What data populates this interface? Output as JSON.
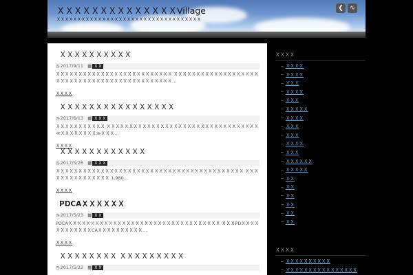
{
  "site": {
    "title": "ＸＸＸＸＸＸＸＸＸＸＸＸＸＸVillage",
    "tagline": "ＸＸＸＸＸＸＸＸＸＸＸＸＸＸＸＸＸＸＸＸＸＸＸＸＸＸＸＸＸＸＸＸＸＸＸ",
    "icons": [
      "feedly-icon",
      "rss-icon"
    ]
  },
  "posts": [
    {
      "title": "ＸＸＸＸＸＸＸＸＸＸ",
      "date": "2017/9/11",
      "category": "ＸＸ",
      "excerpt": "ＸＸＸＸＸＸＸＸＸＸＸＸＸＸＸＸＸＸＸＸＸＸＸＸＸＸ ＸＸＸＸＸＸＸＸＸＸＸＸＸＸＸＸＸＸＸＸＸＸＸＸＸＸＸＸＸＸＸＸＸＸＸＸＸＸＸＸＸＸＸＸＸ…",
      "more": "ＸＸＸＸ"
    },
    {
      "title": "ＸＸＸＸＸＸＸＸＸＸＸＸＸＸＸＸ",
      "date": "2017/6/13",
      "category": "ＸＸＸ",
      "excerpt": "ＸＸＸＸＸＸＸＸＸＸＸ ＸＸＸＸＸＸＸＸＸＸＸＸＸＸＸＸＸＸＸＸＸＸＸＸＸＸＸＸＸＸＸＸＸＸ ≪ＸＸＸＸＸＸＸＸ≫ＸＸＸ…",
      "more": "ＸＸＸＸ"
    },
    {
      "title": "ＸＸＸＸＸＸＸＸＸＸＸＸ",
      "date": "2017/5/26",
      "category": "ＸＸＸ",
      "excerpt": "ＸＸＸＸＸＸＸＸＸＸＸＸＸＸＸＸＸＸＸＸＸＸＸＸＸＸＸＸＸＸＸＸＸＸＸＸＸＸＸＸＸＸ ＸＸＸＸＸＸＸＸＸＸＸＸＸＸＸ 1,980…",
      "more": "ＸＸＸＸ"
    },
    {
      "title": "PDCAＸＸＸＸＸＸ",
      "date": "2017/5/23",
      "category": "ＸＸ",
      "excerpt": "PDCAＸＸＸＸＸＸＸＸＸＸＸＸＸＸＸＸＸＸＸＸＸＸＸＸＸＸＸＸＸＸＸＸＸＸ ＸＸＸPDＸＸＸＸＸＸＸＸＸＸＸＸCAＸＸＸＸＸＸＸＸＸＸ…",
      "more": "ＸＸＸＸ"
    },
    {
      "title": "ＸＸＸＸＸＸＸＸ ＸＸＸＸＸＸＸＸＸ",
      "date": "2017/5/22",
      "category": "ＸＸ",
      "excerpt": "",
      "more": ""
    }
  ],
  "sidebar": {
    "categories_title": "ＸＸＸＸ",
    "categories": [
      "ＸＸＸＸ",
      "ＸＸＸＸ",
      "ＸＸＸ",
      "ＸＸＸＸ",
      "ＸＸＸ",
      "ＸＸＸＸＸ",
      "ＸＸＸＸ",
      "ＸＸＸ",
      "ＸＸＸ",
      "ＸＸＸＸ",
      "ＸＸＸ",
      "ＸＸＸＸＸＸ",
      "ＸＸＸＸＸ",
      "ＸＸ",
      "ＸＸ",
      "ＸＸ",
      "ＸＸ",
      "ＸＸ",
      "ＸＸ"
    ],
    "recent_title": "ＸＸＸＸ",
    "recent": [
      "ＸＸＸＸＸＸＸＸＸＸ",
      "ＸＸＸＸＸＸＸＸＸＸＸＸＸＸＸＸ"
    ]
  }
}
